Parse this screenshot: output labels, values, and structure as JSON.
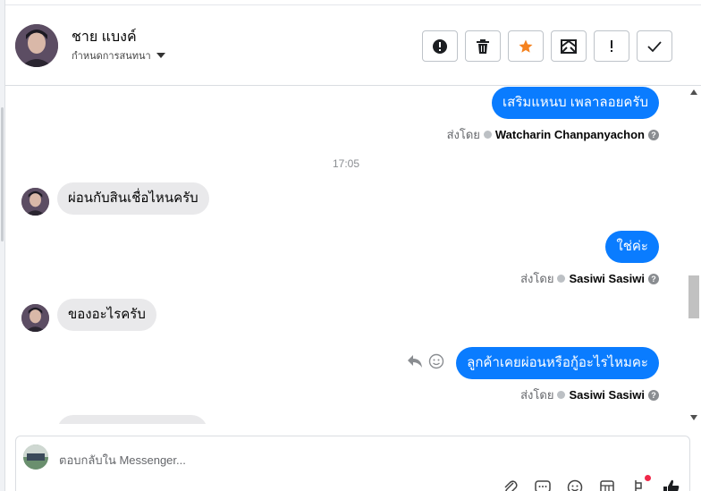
{
  "header": {
    "contact_name": "ชาย แบงค์",
    "assign_label": "กำหนดการสนทนา",
    "actions": [
      {
        "name": "spam-button",
        "icon": "alert-circle-icon"
      },
      {
        "name": "delete-button",
        "icon": "trash-icon"
      },
      {
        "name": "star-button",
        "icon": "star-icon",
        "color": "#f5821f"
      },
      {
        "name": "mark-unread-button",
        "icon": "envelope-icon"
      },
      {
        "name": "follow-up-button",
        "icon": "exclamation-icon"
      },
      {
        "name": "done-button",
        "icon": "check-icon"
      }
    ]
  },
  "conversation": {
    "messages": [
      {
        "dir": "out",
        "text": "เสริมแหนบ เพลาลอยครับ"
      },
      {
        "sent_by_prefix": "ส่งโดย",
        "sender": "Watcharin Chanpanyachon"
      },
      {
        "timestamp": "17:05"
      },
      {
        "dir": "in",
        "text": "ผ่อนกับสินเชื่อไหนครับ"
      },
      {
        "dir": "out",
        "text": "ใช่ค่ะ"
      },
      {
        "sent_by_prefix": "ส่งโดย",
        "sender": "Sasiwi Sasiwi"
      },
      {
        "dir": "in",
        "text": "ของอะไรครับ"
      },
      {
        "dir": "out",
        "text": "ลูกค้าเคยผ่อนหรือกู้อะไรไหมคะ"
      },
      {
        "sent_by_prefix": "ส่งโดย",
        "sender": "Sasiwi Sasiwi"
      }
    ]
  },
  "composer": {
    "placeholder": "ตอบกลับใน Messenger..."
  },
  "colors": {
    "outgoing_bubble": "#0a7cff",
    "incoming_bubble": "#e9e9eb",
    "accent_star": "#f5821f"
  }
}
